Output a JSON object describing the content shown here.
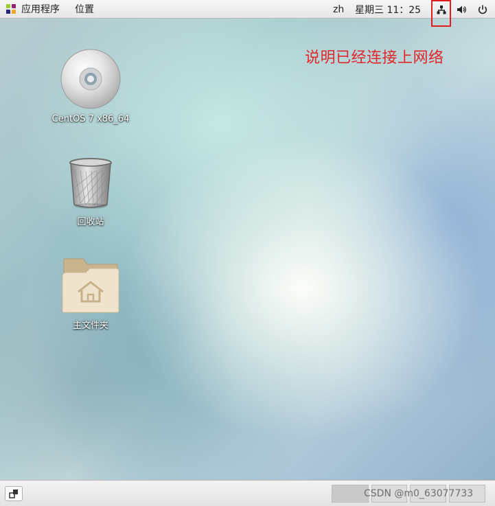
{
  "top_panel": {
    "applications_label": "应用程序",
    "places_label": "位置",
    "language": "zh",
    "clock": "星期三 11：25"
  },
  "annotation": {
    "text": "说明已经连接上网络",
    "color": "#e0262a"
  },
  "desktop": {
    "icons": [
      {
        "label": "CentOS 7 x86_64",
        "icon": "disc-icon"
      },
      {
        "label": "回收站",
        "icon": "trash-icon"
      },
      {
        "label": "主文件夹",
        "icon": "home-folder-icon"
      }
    ]
  },
  "bottom_panel": {
    "watermark": "CSDN @m0_63077733",
    "workspaces": 4,
    "active_workspace": 1
  }
}
